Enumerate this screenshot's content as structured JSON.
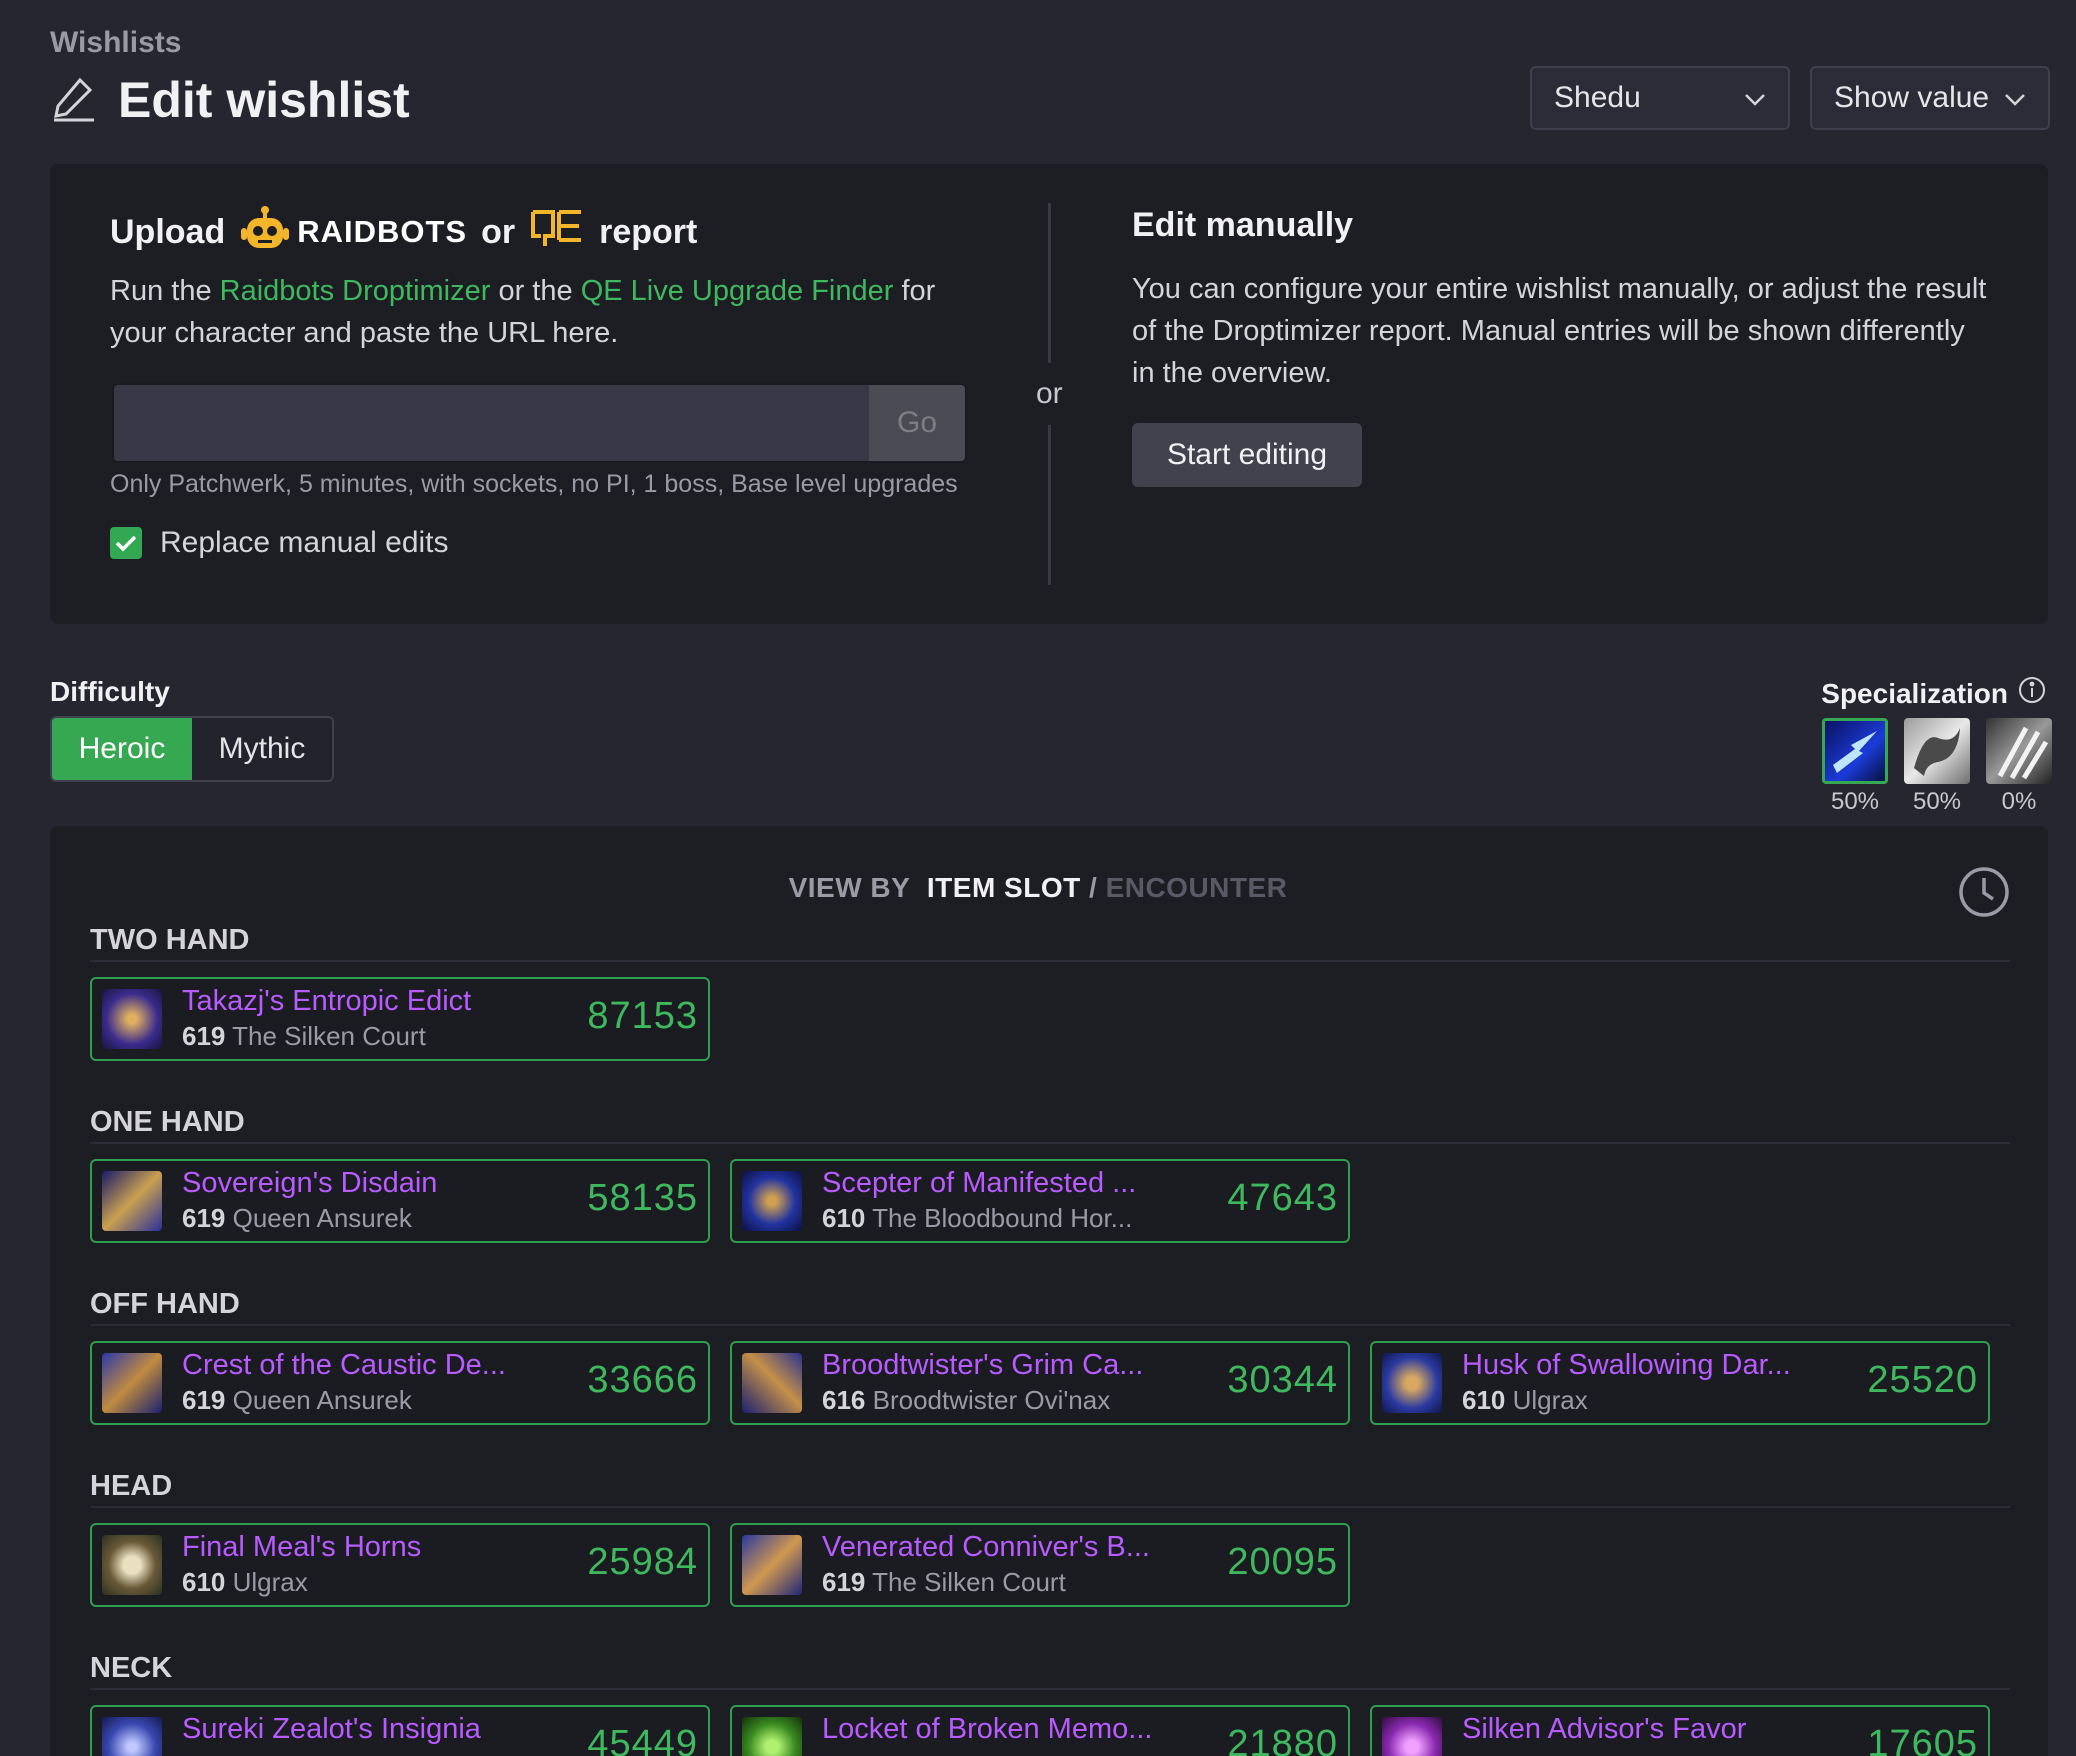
{
  "header": {
    "breadcrumb": "Wishlists",
    "title": "Edit wishlist",
    "character_select": "Shedu",
    "display_select": "Show value"
  },
  "upload": {
    "heading_upload": "Upload",
    "raidbots_word": "RAIDBOTS",
    "heading_or": "or",
    "heading_report": "report",
    "desc_run_the": "Run the",
    "link_droptimizer": "Raidbots Droptimizer",
    "desc_or_the": "or the",
    "link_qe": "QE Live Upgrade Finder",
    "desc_rest": "for your character and paste the URL here.",
    "url_value": "",
    "go_label": "Go",
    "hint": "Only Patchwerk, 5 minutes, with sockets, no PI, 1 boss, Base level upgrades",
    "replace_label": "Replace manual edits",
    "replace_checked": true
  },
  "divider_or": "or",
  "manual": {
    "heading": "Edit manually",
    "desc": "You can configure your entire wishlist manually, or adjust the result of the Droptimizer report. Manual entries will be shown differently in the overview.",
    "button": "Start editing"
  },
  "difficulty": {
    "label": "Difficulty",
    "options": [
      "Heroic",
      "Mythic"
    ],
    "selected": "Heroic"
  },
  "specialization": {
    "label": "Specialization",
    "specs": [
      {
        "icon": "lightning-spec-icon",
        "percent": "50%",
        "selected": true
      },
      {
        "icon": "elemental-spec-icon",
        "percent": "50%",
        "selected": false
      },
      {
        "icon": "claw-spec-icon",
        "percent": "0%",
        "selected": false
      }
    ]
  },
  "view_by": {
    "label": "VIEW BY",
    "active": "ITEM SLOT",
    "separator": "/",
    "inactive": "ENCOUNTER"
  },
  "sections": [
    {
      "name": "TWO HAND",
      "items": [
        {
          "name": "Takazj's Entropic Edict",
          "ilvl": "619",
          "source": "The Silken Court",
          "value": "87153"
        }
      ]
    },
    {
      "name": "ONE HAND",
      "items": [
        {
          "name": "Sovereign's Disdain",
          "ilvl": "619",
          "source": "Queen Ansurek",
          "value": "58135"
        },
        {
          "name": "Scepter of Manifested ...",
          "ilvl": "610",
          "source": "The Bloodbound Hor...",
          "value": "47643"
        }
      ]
    },
    {
      "name": "OFF HAND",
      "items": [
        {
          "name": "Crest of the Caustic De...",
          "ilvl": "619",
          "source": "Queen Ansurek",
          "value": "33666"
        },
        {
          "name": "Broodtwister's Grim Ca...",
          "ilvl": "616",
          "source": "Broodtwister Ovi'nax",
          "value": "30344"
        },
        {
          "name": "Husk of Swallowing Dar...",
          "ilvl": "610",
          "source": "Ulgrax",
          "value": "25520"
        }
      ]
    },
    {
      "name": "HEAD",
      "items": [
        {
          "name": "Final Meal's Horns",
          "ilvl": "610",
          "source": "Ulgrax",
          "value": "25984"
        },
        {
          "name": "Venerated Conniver's B...",
          "ilvl": "619",
          "source": "The Silken Court",
          "value": "20095"
        }
      ]
    },
    {
      "name": "NECK",
      "items": [
        {
          "name": "Sureki Zealot's Insignia",
          "ilvl": "",
          "source": "",
          "value": "45449"
        },
        {
          "name": "Locket of Broken Memo...",
          "ilvl": "",
          "source": "",
          "value": "21880"
        },
        {
          "name": "Silken Advisor's Favor",
          "ilvl": "",
          "source": "",
          "value": "17605"
        }
      ]
    }
  ],
  "colors": {
    "background": "#262631",
    "card": "#1d1d24",
    "accent_green": "#3fb95e",
    "epic_purple": "#b85bff"
  }
}
